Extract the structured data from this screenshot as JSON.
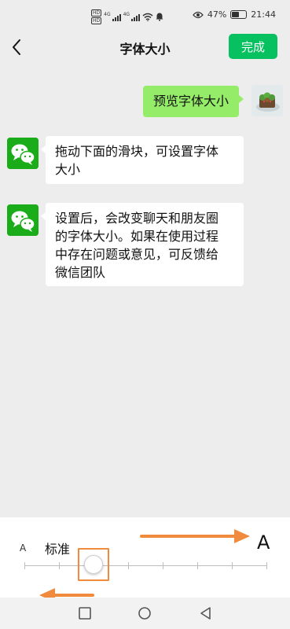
{
  "status_bar": {
    "hd_badge_top": "HD",
    "hd_badge_bottom": "HD",
    "network_label": "4G",
    "battery_percent": "47%",
    "battery_level": 0.47,
    "time": "21:44",
    "icons": [
      "hd-icon",
      "signal-icon",
      "wifi-icon",
      "notification-bell-icon",
      "eye-icon",
      "battery-icon"
    ]
  },
  "nav": {
    "back_icon": "chevron-left-icon",
    "title": "字体大小",
    "done_label": "完成",
    "accent_color": "#07c160"
  },
  "chat": {
    "preview_message": "预览字体大小",
    "messages": [
      {
        "lines": [
          "拖动下面的滑块，可设置字体",
          "大小"
        ]
      },
      {
        "lines": [
          "设置后，会改变聊天和朋友圈",
          "的字体大小。如果在使用过程",
          "中存在问题或意见，可反馈给",
          "微信团队"
        ]
      }
    ],
    "my_bubble_color": "#95ec69",
    "other_bubble_color": "#ffffff"
  },
  "font_size_panel": {
    "small_label": "A",
    "current_label": "标准",
    "large_label": "A",
    "tick_count": 8,
    "selected_index": 2,
    "highlight_color": "#f08a3c"
  },
  "system_nav": {
    "buttons": [
      "recent-apps-icon",
      "home-icon",
      "back-triangle-icon"
    ]
  }
}
